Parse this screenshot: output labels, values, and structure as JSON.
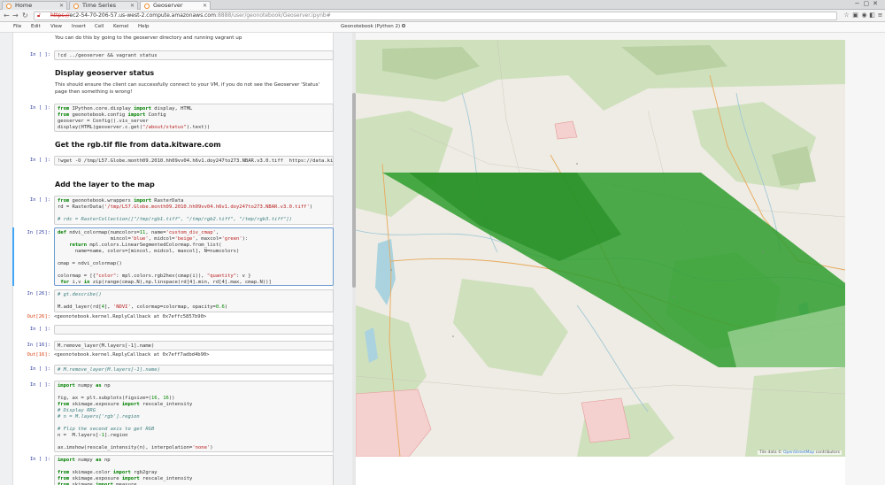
{
  "browser": {
    "tabs": [
      {
        "label": "Home"
      },
      {
        "label": "Time Series"
      },
      {
        "label": "Geoserver"
      }
    ],
    "url": {
      "protocol": "https://",
      "host": "ec2-54-70-206-57.us-west-2.compute.amazonaws.com",
      "path": ":8888/user/geonotebook/Geoserver.ipynb#"
    }
  },
  "notebook": {
    "menus": [
      "File",
      "Edit",
      "View",
      "Insert",
      "Cell",
      "Kernel",
      "Help"
    ],
    "kernel_label": "Geonotebook (Python 2)",
    "intro_text": "You can do this by going to the geoserver directory and running vagrant up",
    "cells": [
      {
        "prompt": "In [ ]:",
        "code": "!cd ../geoserver && vagrant status"
      },
      {
        "type": "heading",
        "text": "Display geoserver status"
      },
      {
        "type": "md",
        "text": "This should ensure the client can successfully connect to your VM, if you do not see the Geoserver 'Status' page then something is wrong!"
      },
      {
        "prompt": "In [ ]:",
        "code_lines": [
          "from IPython.core.display import display, HTML",
          "from geonotebook.config import Config",
          "geoserver = Config().vis_server",
          "display(HTML(geoserver.c.get(\"/about/status\").text))"
        ]
      },
      {
        "type": "heading",
        "text": "Get the rgb.tif file from data.kitware.com"
      },
      {
        "prompt": "In [ ]:",
        "code": "!wget -O /tmp/L57.Globe.month09.2010.hh09vv04.h6v1.doy247to273.NBAR.v3.0.tiff  https://data.kit"
      },
      {
        "type": "heading",
        "text": "Add the layer to the map"
      },
      {
        "prompt": "In [ ]:",
        "code_lines": [
          "from geonotebook.wrappers import RasterData",
          "rd = RasterData('/tmp/L57.Globe.month09.2010.hh09vv04.h6v1.doy247to273.NBAR.v3.0.tiff')",
          "",
          "# rdc = RasterCollection([\"/tmp/rgb1.tiff\", \"/tmp/rgb2.tiff\", \"/tmp/rgb3.tiff\"])"
        ]
      },
      {
        "prompt": "In [25]:",
        "code_lines": [
          "def ndvi_colormap(numcolors=11, name='custom_div_cmap',",
          "                  mincol='blue', midcol='beige', maxcol='green'):",
          "    return mpl.colors.LinearSegmentedColormap.from_list(",
          "      name=name, colors=[mincol, midcol, maxcol], N=numcolors)",
          "",
          "cmap = ndvi_colormap()",
          "",
          "colormap = [{\"color\": mpl.colors.rgb2hex(cmap(i)), \"quantity\": v }",
          " for i,v in zip(range(cmap.N),np.linspace(rd[4].min, rd[4].max, cmap.N))]"
        ]
      },
      {
        "prompt": "In [26]:",
        "code_lines": [
          "# gt.describe()",
          "",
          "M.add_layer(rd[4], 'NDVI', colormap=colormap, opacity=0.6)"
        ]
      },
      {
        "prompt": "Out[26]:",
        "output": "<geonotebook.kernel.ReplyCallback at 0x7effc5857b90>"
      },
      {
        "prompt": "In [ ]:",
        "code": ""
      },
      {
        "prompt": "In [16]:",
        "code": "M.remove_layer(M.layers[-1].name)"
      },
      {
        "prompt": "Out[16]:",
        "output": "<geonotebook.kernel.ReplyCallback at 0x7eff7adbd4b90>"
      },
      {
        "prompt": "In [ ]:",
        "code": "# M.remove_layer(M.layers[-1].name)"
      },
      {
        "prompt": "In [ ]:",
        "code_lines": [
          "import numpy as np",
          "",
          "fig, ax = plt.subplots(figsize=(16, 16))",
          "from skimage.exposure import rescale_intensity",
          "# Display RRG",
          "# n = M.layers['rgb'].region",
          "",
          "# Flip the second axis to get RGB",
          "n =  M.layers[-1].region",
          "",
          "ax.imshow(rescale_intensity(n), interpolation='none')"
        ]
      },
      {
        "prompt": "In [ ]:",
        "code_lines": [
          "import numpy as np",
          "",
          "from skimage.color import rgb2gray",
          "from skimage.exposure import rescale_intensity",
          "from skimage import measure"
        ]
      }
    ]
  },
  "map": {
    "attribution_prefix": "Tile data ©",
    "attribution_link": "OpenStreetMap",
    "attribution_suffix": "contributors",
    "ndvi_color": "#2e9e2e",
    "base_color": "#eeece4"
  }
}
